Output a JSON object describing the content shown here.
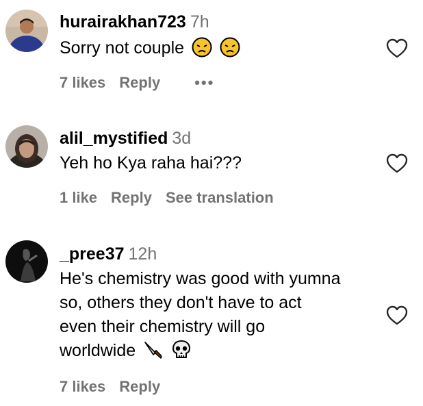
{
  "comments": [
    {
      "username": "hurairakhan723",
      "time": "7h",
      "text": "Sorry not couple",
      "emojis": [
        "pensive-face",
        "pensive-face"
      ],
      "likes": "7 likes",
      "reply": "Reply",
      "more": "•••"
    },
    {
      "username": "alil_mystified",
      "time": "3d",
      "text": "Yeh ho Kya raha hai???",
      "likes": "1 like",
      "reply": "Reply",
      "translate": "See translation"
    },
    {
      "username": "_pree37",
      "time": "12h",
      "text_lines": [
        "He's chemistry was good with yumna",
        "so, others they don't have to act",
        "even their chemistry will go",
        "worldwide"
      ],
      "emojis": [
        "knife",
        "skull"
      ],
      "likes": "7 likes",
      "reply": "Reply"
    }
  ],
  "colors": {
    "secondary_text": "#737373",
    "primary_text": "#000000",
    "background": "#ffffff"
  },
  "icons": [
    "heart-outline-icon"
  ]
}
